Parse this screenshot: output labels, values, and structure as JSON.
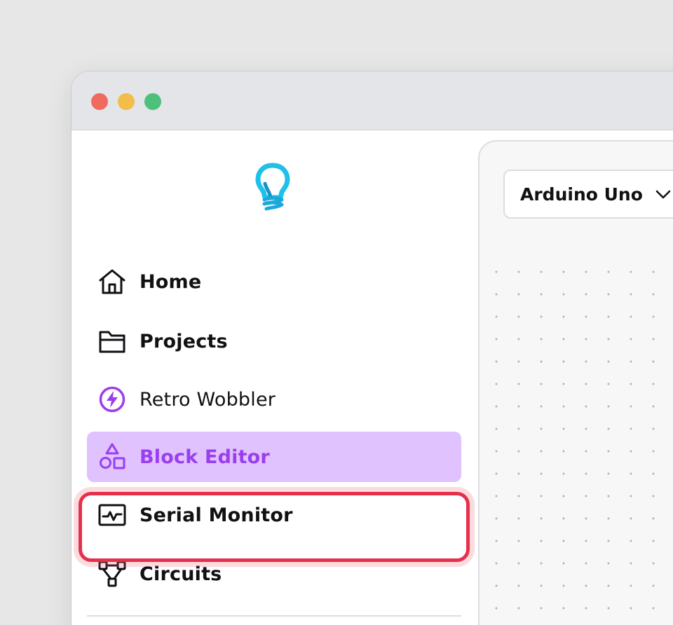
{
  "window": {
    "traffic_lights": [
      "close",
      "minimize",
      "maximize"
    ]
  },
  "sidebar": {
    "logo_icon": "lightbulb-logo-icon",
    "items": [
      {
        "label": "Home",
        "icon": "home-icon",
        "weight": "bold",
        "active": false
      },
      {
        "label": "Projects",
        "icon": "folder-icon",
        "weight": "bold",
        "active": false
      },
      {
        "label": "Retro Wobbler",
        "icon": "lightning-icon",
        "weight": "regular",
        "active": false
      },
      {
        "label": "Block Editor",
        "icon": "shapes-icon",
        "weight": "bold",
        "active": true
      },
      {
        "label": "Serial Monitor",
        "icon": "pulse-monitor-icon",
        "weight": "bold",
        "active": false,
        "highlighted": true
      },
      {
        "label": "Circuits",
        "icon": "circuit-nodes-icon",
        "weight": "bold",
        "active": false
      }
    ]
  },
  "canvas": {
    "board_select": {
      "value": "Arduino Uno",
      "icon": "chevron-down-icon"
    }
  },
  "colors": {
    "accent_purple": "#9a3ef0",
    "active_bg": "#dfc2fe",
    "highlight_red": "#e5304c",
    "logo_cyan": "#1fc0ea",
    "close": "#f06a5e",
    "minimize": "#f2bd49",
    "maximize": "#4dc07a"
  }
}
